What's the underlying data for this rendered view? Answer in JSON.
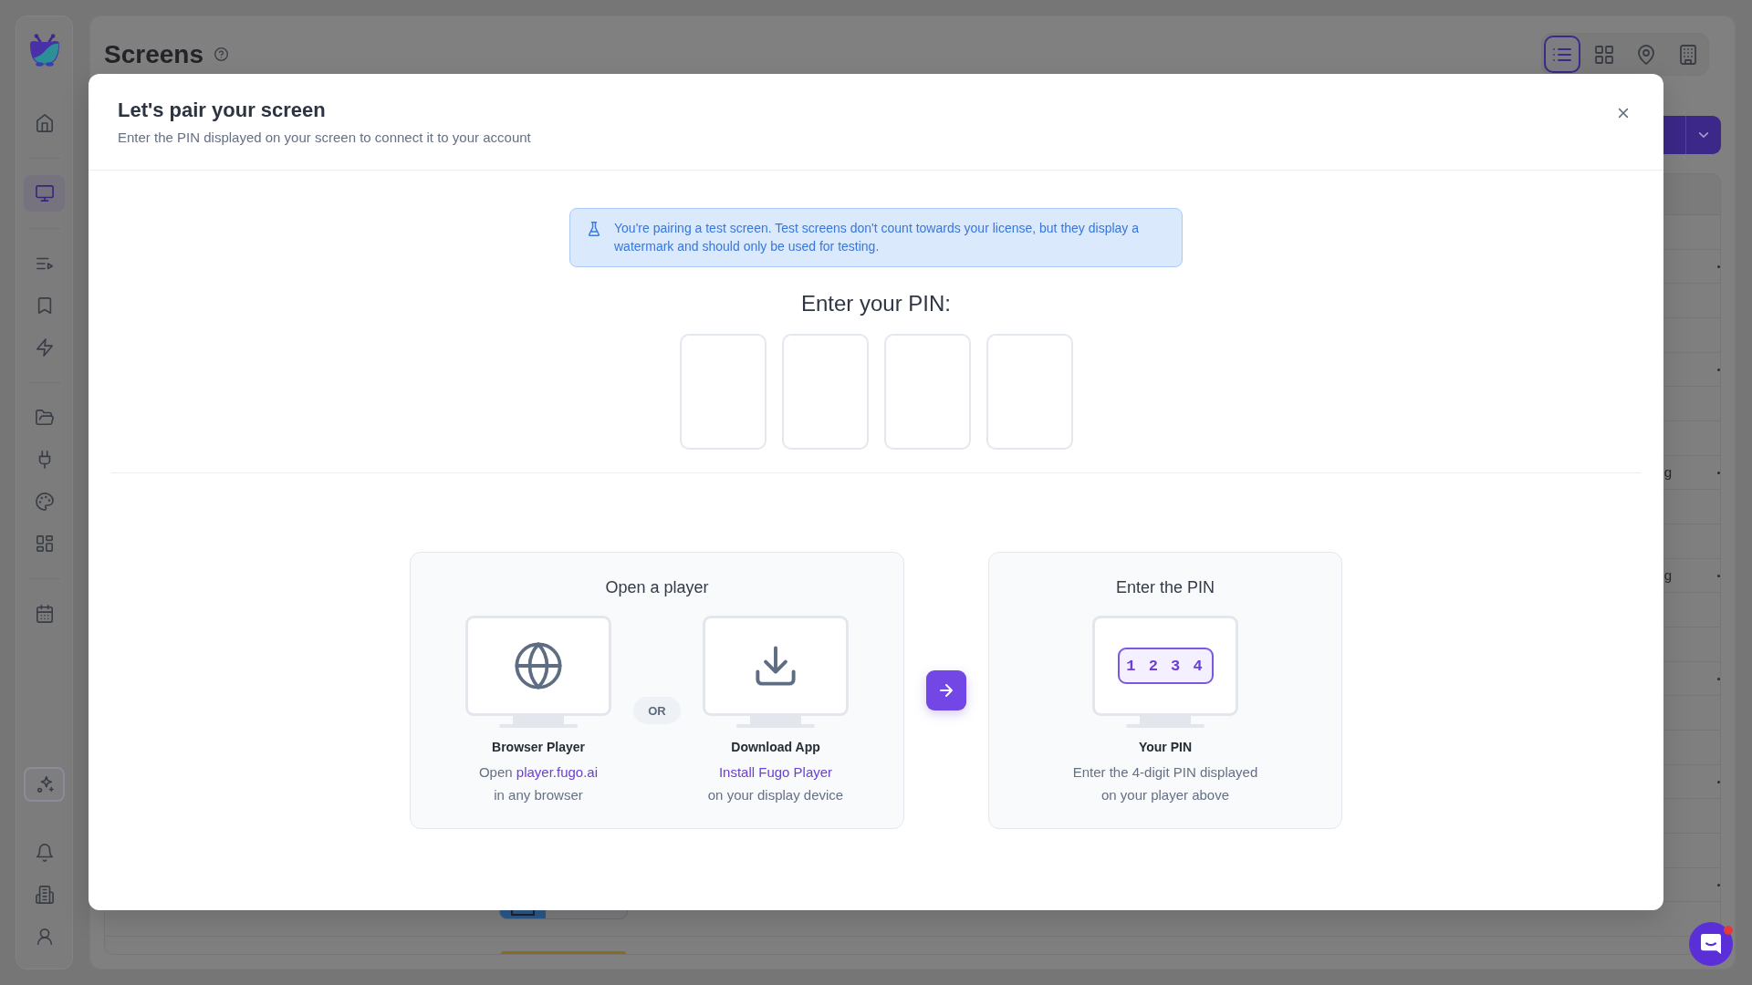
{
  "sidebar": {
    "groups": [
      {
        "items": [
          {
            "selected": false
          }
        ]
      },
      {
        "items": [
          {
            "selected": true
          }
        ]
      },
      {
        "items": [
          {
            "selected": false
          },
          {
            "selected": false
          },
          {
            "selected": false
          }
        ]
      },
      {
        "items": [
          {
            "selected": false
          },
          {
            "selected": false
          },
          {
            "selected": false
          },
          {
            "selected": false
          }
        ]
      },
      {
        "items": [
          {
            "selected": false
          }
        ]
      }
    ],
    "bottom_items": [
      {
        "selected": false
      },
      {
        "selected": false
      },
      {
        "selected": false
      }
    ]
  },
  "page": {
    "title": "Screens",
    "view_options": [
      {
        "selected": true
      },
      {
        "selected": false
      },
      {
        "selected": false
      },
      {
        "selected": false
      }
    ]
  },
  "table": {
    "rows": [
      {
        "kind": "plain"
      },
      {
        "kind": "plain"
      },
      {
        "kind": "plain",
        "column_fragment": "g"
      },
      {
        "kind": "plain",
        "column_fragment": "g"
      },
      {
        "kind": "plain"
      },
      {
        "kind": "plain"
      },
      {
        "kind": "preview"
      },
      {
        "kind": "status"
      }
    ]
  },
  "modal": {
    "title": "Let's pair your screen",
    "subtitle": "Enter the PIN displayed on your screen to connect it to your account",
    "notice": "You're pairing a test screen. Test screens don't count towards your license, but they display a watermark and should only be used for testing.",
    "pin_prompt": "Enter your PIN:",
    "pin_fields": [
      {
        "focused": false
      },
      {
        "focused": false
      },
      {
        "focused": false
      },
      {
        "focused": false
      }
    ],
    "steps": [
      {
        "title": "Open a player",
        "separator": "OR",
        "options": [
          {
            "kind": "browser",
            "label": "Browser Player",
            "lines": [
              [
                {
                  "kind": "text",
                  "text": "Open"
                },
                {
                  "kind": "link",
                  "text": "player.fugo.ai"
                }
              ],
              [
                {
                  "kind": "text",
                  "text": "in any browser"
                }
              ]
            ]
          },
          {
            "kind": "app",
            "label": "Download App",
            "lines": [
              [
                {
                  "kind": "link",
                  "text": "Install Fugo Player"
                }
              ],
              [
                {
                  "kind": "text",
                  "text": "on your display device"
                }
              ]
            ]
          }
        ]
      },
      {
        "title": "Enter the PIN",
        "options": [
          {
            "kind": "pin",
            "label": "Your PIN",
            "pin_example": "1 2 3 4",
            "lines": [
              [
                {
                  "kind": "text",
                  "text": "Enter the 4-digit PIN displayed"
                }
              ],
              [
                {
                  "kind": "text",
                  "text": "on your player above"
                }
              ]
            ]
          }
        ]
      }
    ]
  }
}
